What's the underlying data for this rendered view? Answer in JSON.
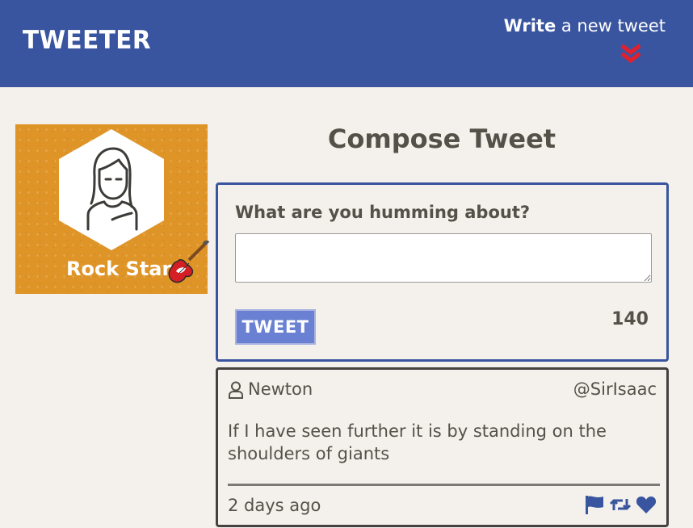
{
  "nav": {
    "brand": "TWEETER",
    "write_strong": "Write",
    "write_rest": " a new tweet",
    "chevron_icon": "double-chevron-down-icon",
    "accent": "#e2202d"
  },
  "profile": {
    "name": "Rock Star",
    "avatar_icon": "user-avatar-icon",
    "badge_icon": "guitar-icon",
    "background": "#de9426"
  },
  "compose": {
    "title": "Compose Tweet",
    "label": "What are you humming about?",
    "input_value": "",
    "submit_label": "TWEET",
    "counter": "140"
  },
  "tweets": [
    {
      "name": "Newton",
      "handle": "@SirIsaac",
      "text": "If I have seen further it is by standing on the shoulders of giants",
      "time": "2 days ago",
      "actions": [
        "flag-icon",
        "retweet-icon",
        "heart-icon"
      ]
    }
  ],
  "colors": {
    "nav": "#3a559f",
    "page": "#f4f1ec",
    "text": "#545149",
    "button": "#6a80d2"
  }
}
